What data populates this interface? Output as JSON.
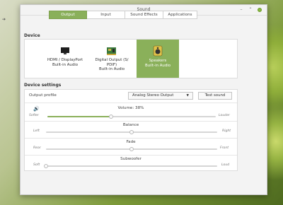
{
  "window": {
    "title": "Sound",
    "controls": {
      "minimize": "–",
      "restore": "⌃",
      "close": "✕"
    }
  },
  "tabs": [
    {
      "label": "Output",
      "active": true
    },
    {
      "label": "Input",
      "active": false
    },
    {
      "label": "Sound Effects",
      "active": false
    },
    {
      "label": "Applications",
      "active": false
    }
  ],
  "device_section": {
    "heading": "Device",
    "devices": [
      {
        "line1": "HDMI / DisplayPort",
        "line2": "Built-in Audio",
        "line3": "",
        "icon": "monitor-icon",
        "selected": false
      },
      {
        "line1": "Digital Output (S/",
        "line2": "PDIF)",
        "line3": "Built-in Audio",
        "icon": "sound-card-icon",
        "selected": false
      },
      {
        "line1": "Speakers",
        "line2": "Built-in Audio",
        "line3": "",
        "icon": "speaker-icon",
        "selected": true
      }
    ]
  },
  "settings_section": {
    "heading": "Device settings",
    "output_profile_label": "Output profile",
    "output_profile_value": "Analog Stereo Output",
    "test_sound_label": "Test sound",
    "volume": {
      "label": "Volume: 38%",
      "value": 0.38,
      "left": "Softer",
      "right": "Louder"
    },
    "balance": {
      "label": "Balance",
      "value": 0.5,
      "left": "Left",
      "right": "Right"
    },
    "fade": {
      "label": "Fade",
      "value": 0.5,
      "left": "Rear",
      "right": "Front"
    },
    "subwoofer": {
      "label": "Subwoofer",
      "value": 0.0,
      "left": "Soft",
      "right": "Loud"
    }
  },
  "colors": {
    "accent": "#8ab05a",
    "window_bg": "#f3f3f3"
  }
}
